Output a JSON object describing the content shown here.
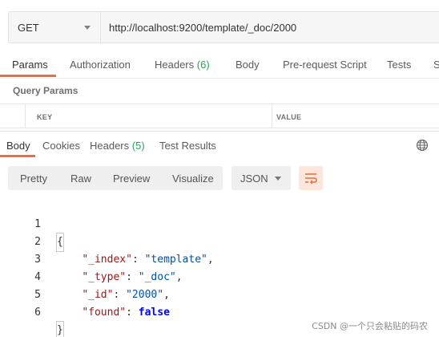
{
  "request": {
    "method": "GET",
    "url": "http://localhost:9200/template/_doc/2000"
  },
  "request_tabs": [
    {
      "label": "Params",
      "count": ""
    },
    {
      "label": "Authorization",
      "count": ""
    },
    {
      "label": "Headers",
      "count": "(6)"
    },
    {
      "label": "Body",
      "count": ""
    },
    {
      "label": "Pre-request Script",
      "count": ""
    },
    {
      "label": "Tests",
      "count": ""
    },
    {
      "label": "S",
      "count": ""
    }
  ],
  "query_params": {
    "title": "Query Params",
    "key_header": "KEY",
    "value_header": "VALUE"
  },
  "response_tabs": [
    {
      "label": "Body",
      "count": ""
    },
    {
      "label": "Cookies",
      "count": ""
    },
    {
      "label": "Headers",
      "count": "(5)"
    },
    {
      "label": "Test Results",
      "count": ""
    }
  ],
  "view_modes": [
    "Pretty",
    "Raw",
    "Preview",
    "Visualize"
  ],
  "format": "JSON",
  "response_body": {
    "line_numbers": [
      "1",
      "2",
      "3",
      "4",
      "5",
      "6"
    ],
    "open_brace": "{",
    "close_brace": "}",
    "fields": [
      {
        "key": "\"_index\"",
        "value": "\"template\"",
        "comma": ","
      },
      {
        "key": "\"_type\"",
        "value": "\"_doc\"",
        "comma": ","
      },
      {
        "key": "\"_id\"",
        "value": "\"2000\"",
        "comma": ","
      },
      {
        "key": "\"found\"",
        "value": "false",
        "comma": ""
      }
    ]
  },
  "watermark": "CSDN @一个只会粘贴的码农",
  "colors": {
    "accent": "#f26b3a",
    "count": "#26a55b",
    "json_key": "#a31515",
    "json_string": "#0451a5",
    "json_boolean": "#0000ff"
  },
  "icons": [
    "chevron-down-icon",
    "globe-icon",
    "wrap-lines-icon"
  ]
}
